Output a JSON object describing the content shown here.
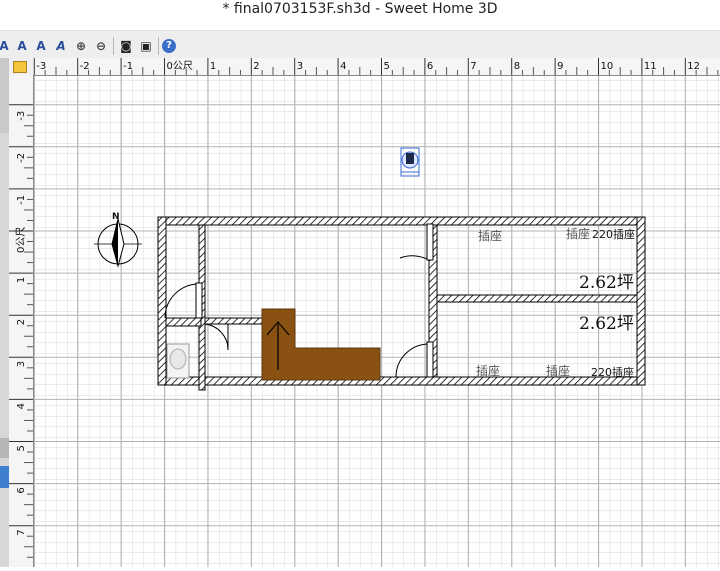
{
  "window": {
    "title": "* final0703153F.sh3d - Sweet Home 3D"
  },
  "toolbar": {
    "buttons": [
      {
        "name": "text-style-icon-1",
        "glyph": "A"
      },
      {
        "name": "text-style-icon-2",
        "glyph": "A"
      },
      {
        "name": "text-style-icon-3",
        "glyph": "A"
      },
      {
        "name": "text-style-icon-4",
        "glyph": "A"
      },
      {
        "name": "zoom-in-icon",
        "glyph": "⊕"
      },
      {
        "name": "zoom-out-icon",
        "glyph": "⊖"
      },
      {
        "name": "camera-icon",
        "glyph": "◙"
      },
      {
        "name": "video-icon",
        "glyph": "▣"
      },
      {
        "name": "help-icon",
        "glyph": "?"
      }
    ]
  },
  "ruler": {
    "h_labels": [
      "-3",
      "-2",
      "-1",
      "0公尺",
      "1",
      "2",
      "3",
      "4",
      "5",
      "6",
      "7",
      "8",
      "9",
      "10",
      "11",
      "12"
    ],
    "v_labels": [
      "-3",
      "-2",
      "-1",
      "0公尺",
      "1",
      "2",
      "3",
      "4",
      "5",
      "6",
      "7"
    ]
  },
  "plan": {
    "compass_label": "N",
    "outlets": [
      "插座",
      "插座",
      "插座",
      "插座"
    ],
    "outlet_220": [
      "220插座",
      "220插座"
    ],
    "room_areas": [
      "2.62坪",
      "2.62坪"
    ]
  },
  "colors": {
    "wall_fill": "#ffffff",
    "hatch": "#000000",
    "furniture": "#8a5212",
    "grid_minor": "#dddddd",
    "grid_major": "#b0b0b0"
  }
}
